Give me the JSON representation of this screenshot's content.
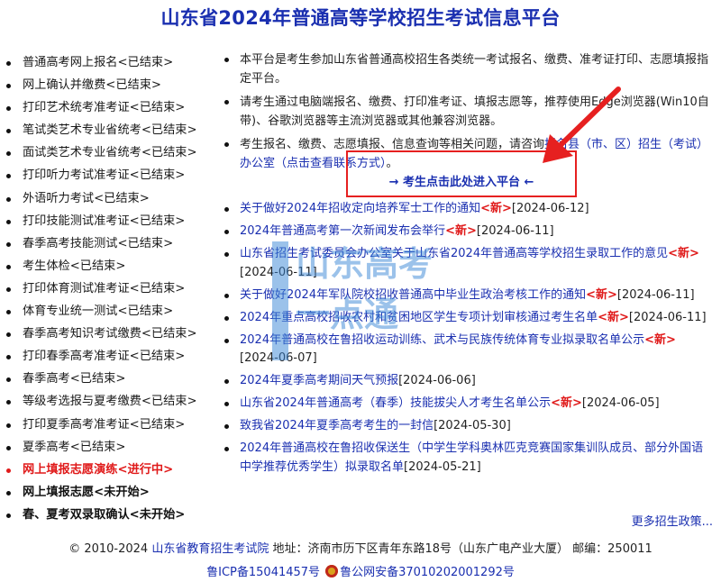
{
  "page": {
    "title": "山东省2024年普通高等学校招生考试信息平台"
  },
  "sidebar": {
    "items": [
      {
        "label": "普通高考网上报名<已结束>"
      },
      {
        "label": "网上确认并缴费<已结束>"
      },
      {
        "label": "打印艺术统考准考证<已结束>"
      },
      {
        "label": "笔试类艺术专业省统考<已结束>"
      },
      {
        "label": "面试类艺术专业省统考<已结束>"
      },
      {
        "label": "打印听力考试准考证<已结束>"
      },
      {
        "label": "外语听力考试<已结束>"
      },
      {
        "label": "打印技能测试准考证<已结束>"
      },
      {
        "label": "春季高考技能测试<已结束>"
      },
      {
        "label": "考生体检<已结束>"
      },
      {
        "label": "打印体育测试准考证<已结束>"
      },
      {
        "label": "体育专业统一测试<已结束>"
      },
      {
        "label": "春季高考知识考试缴费<已结束>"
      },
      {
        "label": "打印春季高考准考证<已结束>"
      },
      {
        "label": "春季高考<已结束>"
      },
      {
        "label": "等级考选报与夏考缴费<已结束>"
      },
      {
        "label": "打印夏季高考准考证<已结束>"
      },
      {
        "label": "夏季高考<已结束>"
      },
      {
        "label": "网上填报志愿演练<进行中>"
      },
      {
        "label": "网上填报志愿<未开始>"
      },
      {
        "label": "春、夏考双录取确认<未开始>"
      }
    ]
  },
  "notices": {
    "n1": "本平台是考生参加山东省普通高校招生各类统一考试报名、缴费、准考证打印、志愿填报指定平台。",
    "n2": "请考生通过电脑端报名、缴费、打印准考证、填报志愿等，推荐使用Edge浏览器(Win10自带)、谷歌浏览器等主流浏览器或其他兼容浏览器。",
    "n3_text": "考生报名、缴费、志愿填报、信息查询等相关问题，请咨询",
    "n3_link": "报名县（市、区）招生（考试）办公室（点击查看联系方式）",
    "n3_end": "。",
    "enter_link": "→ 考生点击此处进入平台 ←"
  },
  "news": {
    "new_tag": "<新>",
    "items": [
      {
        "title": "关于做好2024年招收定向培养军士工作的通知",
        "new": true,
        "date": "[2024-06-12]"
      },
      {
        "title": "2024年普通高考第一次新闻发布会举行",
        "new": true,
        "date": "[2024-06-11]"
      },
      {
        "title": "山东省招生考试委员会办公室关于山东省2024年普通高等学校招生录取工作的意见",
        "new": true,
        "date": "[2024-06-11]"
      },
      {
        "title": "关于做好2024年军队院校招收普通高中毕业生政治考核工作的通知",
        "new": true,
        "date": "[2024-06-11]"
      },
      {
        "title": "2024年重点高校招收农村和贫困地区学生专项计划审核通过考生名单",
        "new": true,
        "date": "[2024-06-11]"
      },
      {
        "title": "2024年普通高校在鲁招收运动训练、武术与民族传统体育专业拟录取名单公示",
        "new": true,
        "date": "[2024-06-07]"
      },
      {
        "title": "2024年夏季高考期间天气预报",
        "new": false,
        "date": "[2024-06-06]"
      },
      {
        "title": "山东省2024年普通高考（春季）技能拔尖人才考生名单公示",
        "new": true,
        "date": "[2024-06-05]"
      },
      {
        "title": "致我省2024年夏季高考考生的一封信",
        "new": false,
        "date": "[2024-05-30]"
      },
      {
        "title": "2024年普通高校在鲁招收保送生（中学生学科奥林匹克竞赛国家集训队成员、部分外国语中学推荐优秀学生）拟录取名单",
        "new": false,
        "date": "[2024-05-21]"
      }
    ],
    "more": "更多招生政策..."
  },
  "footer": {
    "copyright": "© 2010-2024",
    "org_link": "山东省教育招生考试院",
    "address": "地址：济南市历下区青年东路18号（山东广电产业大厦）  邮编：250011",
    "icp": "鲁ICP备15041457号",
    "police": "鲁公网安备37010202001292号"
  },
  "watermark": {
    "line1": "山东高考",
    "line2": "一点通"
  },
  "colors": {
    "link": "#1a2fb0",
    "highlight": "#e01a1a",
    "annotation": "#e62020"
  },
  "icons": {
    "arrow": "red-arrow-annotation",
    "police": "police-badge-icon"
  }
}
